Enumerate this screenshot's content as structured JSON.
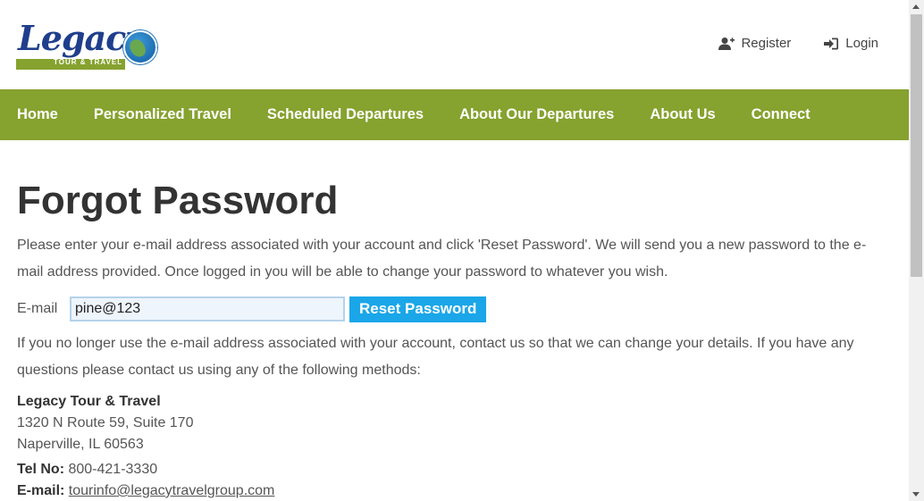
{
  "logo": {
    "script": "Legacy",
    "sub": "TOUR & TRAVEL"
  },
  "top_links": {
    "register": "Register",
    "login": "Login"
  },
  "nav": [
    "Home",
    "Personalized Travel",
    "Scheduled Departures",
    "About Our Departures",
    "About Us",
    "Connect"
  ],
  "page": {
    "title": "Forgot Password",
    "intro": "Please enter your e-mail address associated with your account and click 'Reset Password'. We will send you a new password to the e-mail address provided. Once logged in you will be able to change your password to whatever you wish.",
    "email_label": "E-mail",
    "email_value": "pine@123",
    "reset_button": "Reset Password",
    "help": "If you no longer use the e-mail address associated with your account, contact us so that we can change your details. If you have any questions please contact us using any of the following methods:"
  },
  "contact": {
    "company": "Legacy Tour & Travel",
    "address1": "1320 N Route 59, Suite 170",
    "address2": "Naperville, IL 60563",
    "tel_label": "Tel No:",
    "tel": "800-421-3330",
    "email_label": "E-mail:",
    "email": "tourinfo@legacytravelgroup.com"
  },
  "colors": {
    "nav_bg": "#86a22f",
    "button_bg": "#1aa6e8",
    "logo_blue": "#1f3e8c"
  },
  "icons": {
    "register": "user-plus-icon",
    "login": "sign-in-icon"
  }
}
